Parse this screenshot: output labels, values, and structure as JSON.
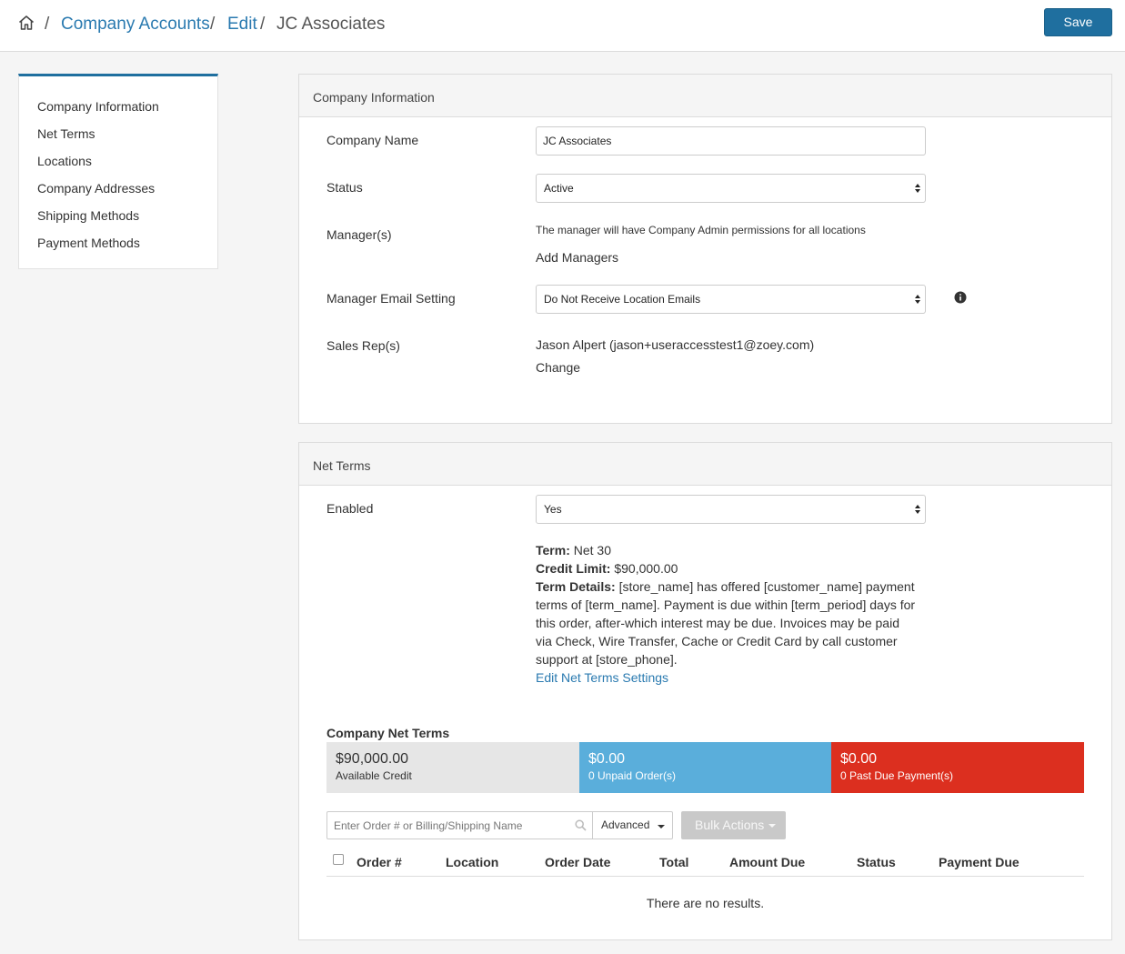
{
  "breadcrumb": {
    "items": [
      "Company Accounts",
      "Edit"
    ],
    "separator": "/",
    "current": "JC Associates"
  },
  "header": {
    "save_label": "Save"
  },
  "sidebar": {
    "items": [
      {
        "label": "Company Information"
      },
      {
        "label": "Net Terms"
      },
      {
        "label": "Locations"
      },
      {
        "label": "Company Addresses"
      },
      {
        "label": "Shipping Methods"
      },
      {
        "label": "Payment Methods"
      }
    ]
  },
  "company_info": {
    "title": "Company Information",
    "company_name_label": "Company Name",
    "company_name_value": "JC Associates",
    "status_label": "Status",
    "status_value": "Active",
    "managers_label": "Manager(s)",
    "managers_note": "The manager will have Company Admin permissions for all locations",
    "add_managers_link": "Add Managers",
    "manager_email_label": "Manager Email Setting",
    "manager_email_value": "Do Not Receive Location Emails",
    "sales_rep_label": "Sales Rep(s)",
    "sales_rep_value": "Jason Alpert (jason+useraccesstest1@zoey.com)",
    "change_link": "Change"
  },
  "net_terms": {
    "title": "Net Terms",
    "enabled_label": "Enabled",
    "enabled_value": "Yes",
    "term_label": "Term:",
    "term_value": "Net 30",
    "credit_limit_label": "Credit Limit:",
    "credit_limit_value": "$90,000.00",
    "term_details_label": "Term Details:",
    "term_details_value": "[store_name] has offered [customer_name] payment terms of [term_name]. Payment is due within [term_period] days for this order, after-which interest may be due. Invoices may be paid via Check, Wire Transfer, Cache or Credit Card by call customer support at [store_phone].",
    "edit_settings_link": "Edit Net Terms Settings",
    "company_net_terms_heading": "Company Net Terms",
    "stats": [
      {
        "amount": "$90,000.00",
        "label": "Available Credit",
        "color": "#e6e6e6"
      },
      {
        "amount": "$0.00",
        "label": "0 Unpaid Order(s)",
        "color": "#5aaedb"
      },
      {
        "amount": "$0.00",
        "label": "0 Past Due Payment(s)",
        "color": "#dc2f1f"
      }
    ],
    "search_placeholder": "Enter Order # or Billing/Shipping Name",
    "advanced_label": "Advanced",
    "bulk_actions_label": "Bulk Actions",
    "columns": [
      "Order #",
      "Location",
      "Order Date",
      "Total",
      "Amount Due",
      "Status",
      "Payment Due"
    ],
    "empty_message": "There are no results."
  },
  "colors": {
    "primary": "#1f6f9f",
    "link": "#2a7ab0",
    "unpaid": "#5aaedb",
    "past_due": "#dc2f1f"
  }
}
